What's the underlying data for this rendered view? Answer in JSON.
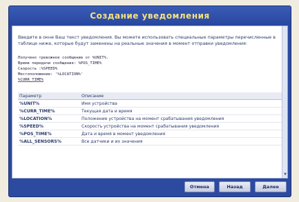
{
  "window": {
    "title": "Создание уведомления"
  },
  "intro_text": "Введите в окне Ваш текст уведомления. Вы можете использовать специальные параметры перечисленные в таблице ниже, которые будут заменены на реальные значения в момент отправки уведомления:",
  "message_lines": [
    "Получено тревожное сообщение от %UNIT%.",
    "Время передачи сообщения: %POS_TIME%",
    "Скорость :%SPEED%",
    "Местоположение: '%LOCATION%'",
    "%CURR_TIME%"
  ],
  "table": {
    "headers": {
      "param": "Параметр",
      "desc": "Описание"
    },
    "rows": [
      {
        "param": "%UNIT%",
        "desc": "Имя устройства"
      },
      {
        "param": "%CURR_TIME%",
        "desc": "Текущая дата и время"
      },
      {
        "param": "%LOCATION%",
        "desc": "Положение устройства на момент срабатывания уведомления"
      },
      {
        "param": "%SPEED%",
        "desc": "Скорость устройства на момент срабатывания уведомления"
      },
      {
        "param": "%POS_TIME%",
        "desc": "Дата и время в момент уведомления"
      },
      {
        "param": "%ALL_SENSORS%",
        "desc": "Все датчики и их значения"
      }
    ]
  },
  "buttons": {
    "cancel": "Отмена",
    "back": "Назад",
    "next": "Далее"
  },
  "icons": {
    "scroll_down": "scroll-down-arrow-icon"
  }
}
